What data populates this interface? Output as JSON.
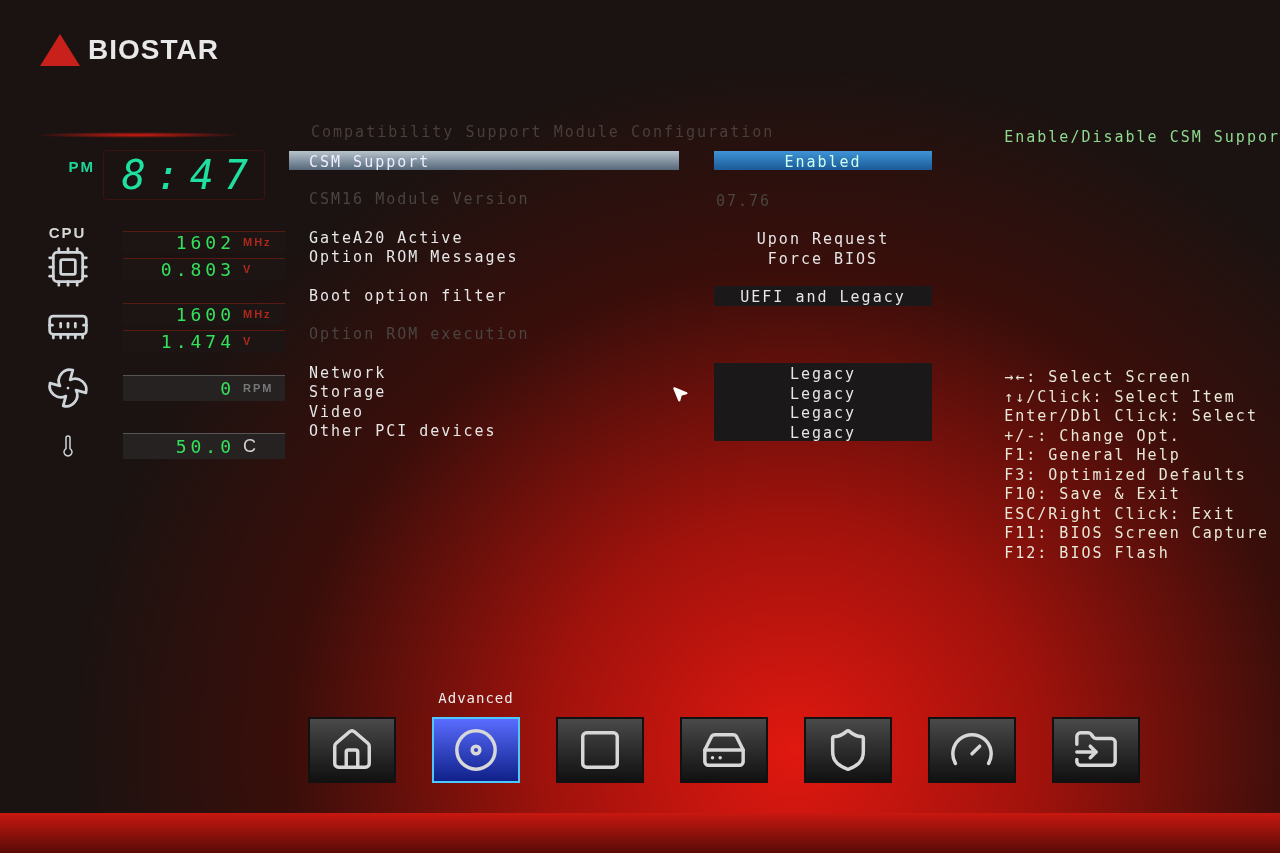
{
  "logo": {
    "text": "BIOSTAR"
  },
  "clock": {
    "period": "PM",
    "time": "8:47"
  },
  "monitors": [
    {
      "kind": "cpu",
      "label": "CPU",
      "readings": [
        {
          "value": "1602",
          "unit": "MHz"
        },
        {
          "value": "0.803",
          "unit": "V"
        }
      ]
    },
    {
      "kind": "memory",
      "readings": [
        {
          "value": "1600",
          "unit": "MHz"
        },
        {
          "value": "1.474",
          "unit": "V"
        }
      ]
    },
    {
      "kind": "fan",
      "readings": [
        {
          "value": "0",
          "unit": "RPM"
        }
      ]
    },
    {
      "kind": "temperature",
      "readings": [
        {
          "value": "50.0",
          "unit": "C"
        }
      ]
    }
  ],
  "page_title": "Compatibility Support Module Configuration",
  "groups": [
    {
      "boxed": false,
      "items": [
        {
          "label": "CSM Support",
          "value": "Enabled",
          "selected": true,
          "disabled": false
        }
      ]
    },
    {
      "boxed": false,
      "items": [
        {
          "label": "CSM16 Module Version",
          "value": "07.76",
          "selected": false,
          "disabled": true
        }
      ]
    },
    {
      "boxed": false,
      "items": [
        {
          "label": "GateA20 Active",
          "value": "Upon Request",
          "selected": false,
          "disabled": false
        },
        {
          "label": "Option ROM Messages",
          "value": "Force BIOS",
          "selected": false,
          "disabled": false
        }
      ]
    },
    {
      "boxed": true,
      "items": [
        {
          "label": "Boot option filter",
          "value": "UEFI and Legacy",
          "selected": false,
          "disabled": false
        }
      ]
    },
    {
      "boxed": false,
      "items": [
        {
          "label": "Option ROM execution",
          "selected": false,
          "disabled": true
        }
      ]
    },
    {
      "boxed": true,
      "items": [
        {
          "label": "Network",
          "value": "Legacy",
          "selected": false,
          "disabled": false
        },
        {
          "label": "Storage",
          "value": "Legacy",
          "selected": false,
          "disabled": false
        },
        {
          "label": "Video",
          "value": "Legacy",
          "selected": false,
          "disabled": false
        },
        {
          "label": "Other PCI devices",
          "value": "Legacy",
          "selected": false,
          "disabled": false
        }
      ]
    }
  ],
  "help_text": "Enable/Disable CSM Suppor",
  "key_help": [
    "→←: Select Screen",
    "↑↓/Click: Select Item",
    "Enter/Dbl Click: Select",
    "+/-: Change Opt.",
    "F1: General Help",
    "F3: Optimized Defaults",
    "F10: Save & Exit",
    "ESC/Right Click: Exit",
    "F11: BIOS Screen Capture",
    "F12: BIOS Flash"
  ],
  "tabs": [
    {
      "kind": "home",
      "selected": false
    },
    {
      "kind": "advanced",
      "label": "Advanced",
      "selected": true
    },
    {
      "kind": "chipset",
      "selected": false
    },
    {
      "kind": "boot",
      "selected": false
    },
    {
      "kind": "security",
      "selected": false
    },
    {
      "kind": "performance",
      "selected": false
    },
    {
      "kind": "exit",
      "selected": false
    }
  ]
}
